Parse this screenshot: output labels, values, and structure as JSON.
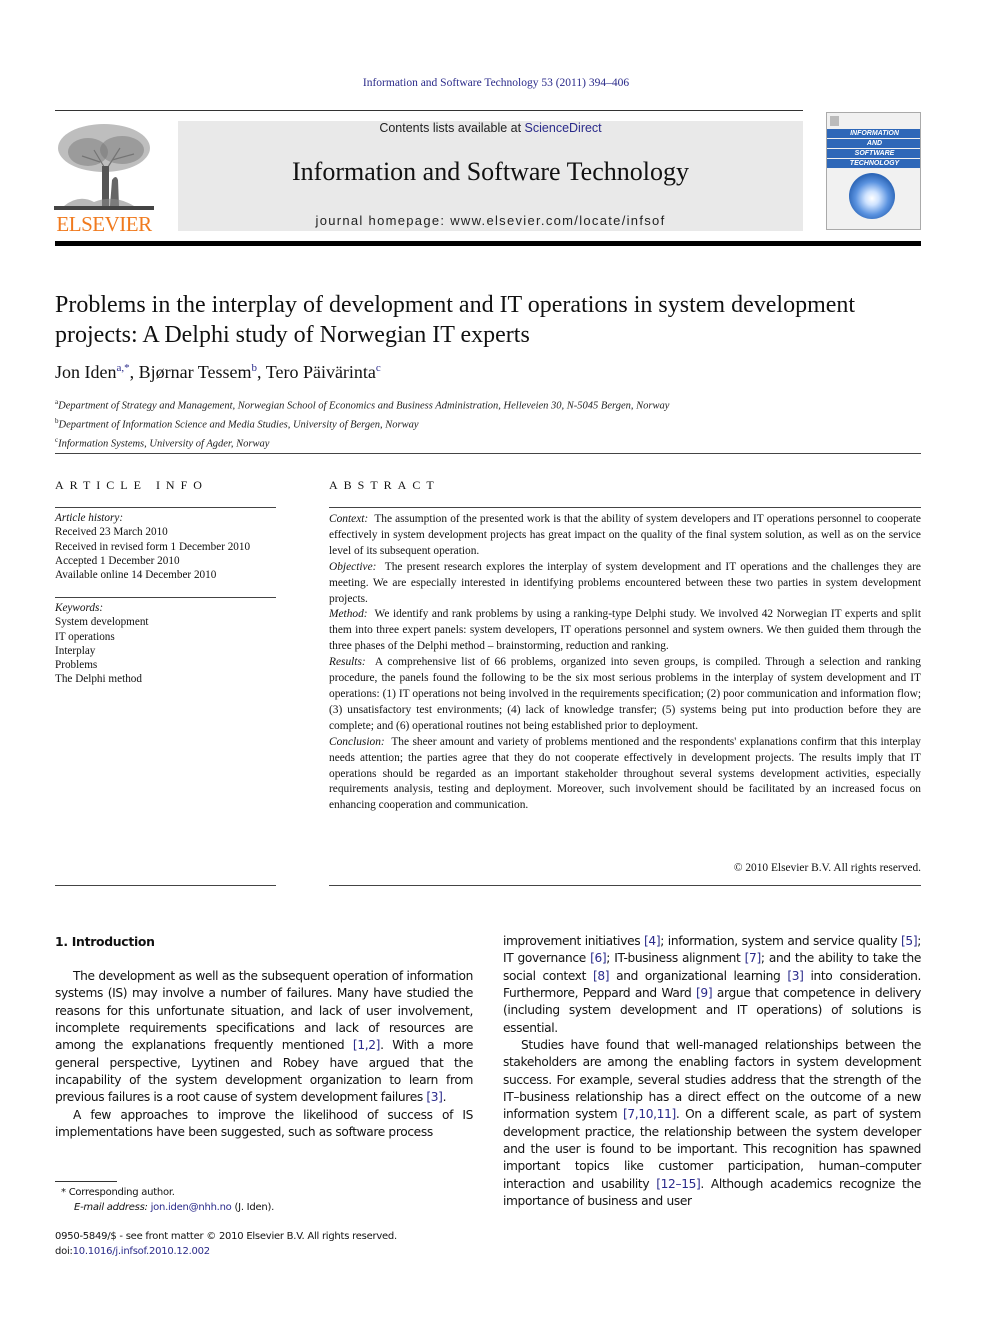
{
  "journal": {
    "running_head": "Information and Software Technology 53 (2011) 394–406",
    "contents_prefix": "Contents lists available at ",
    "contents_link": "ScienceDirect",
    "title": "Information and Software Technology",
    "homepage": "journal homepage: www.elsevier.com/locate/infsof",
    "publisher_logo": "ELSEVIER",
    "cover_lines": [
      "INFORMATION",
      "AND",
      "SOFTWARE",
      "TECHNOLOGY"
    ],
    "brand_color": "#f07a1e",
    "link_color": "#2a2a8a",
    "cover_color": "#2e67b8"
  },
  "article": {
    "title": "Problems in the interplay of development and IT operations in system development projects: A Delphi study of Norwegian IT experts",
    "authors": [
      {
        "name": "Jon Iden",
        "marks": "a,*",
        "sep": ", "
      },
      {
        "name": "Bjørnar Tessem",
        "marks": "b",
        "sep": ", "
      },
      {
        "name": "Tero Päivärinta",
        "marks": "c",
        "sep": ""
      }
    ],
    "affiliations": [
      {
        "mark": "a",
        "text": "Department of Strategy and Management, Norwegian School of Economics and Business Administration, Helleveien 30, N-5045 Bergen, Norway"
      },
      {
        "mark": "b",
        "text": "Department of Information Science and Media Studies, University of Bergen, Norway"
      },
      {
        "mark": "c",
        "text": "Information Systems, University of Agder, Norway"
      }
    ]
  },
  "article_info": {
    "heading": "ARTICLE INFO",
    "history_label": "Article history:",
    "history": [
      "Received 23 March 2010",
      "Received in revised form 1 December 2010",
      "Accepted 1 December 2010",
      "Available online 14 December 2010"
    ],
    "keywords_label": "Keywords:",
    "keywords": [
      "System development",
      "IT operations",
      "Interplay",
      "Problems",
      "The Delphi method"
    ]
  },
  "abstract": {
    "heading": "ABSTRACT",
    "sections": [
      {
        "label": "Context:",
        "text": "The assumption of the presented work is that the ability of system developers and IT operations personnel to cooperate effectively in system development projects has great impact on the quality of the final system solution, as well as on the service level of its subsequent operation."
      },
      {
        "label": "Objective:",
        "text": "The present research explores the interplay of system development and IT operations and the challenges they are meeting. We are especially interested in identifying problems encountered between these two parties in system development projects."
      },
      {
        "label": "Method:",
        "text": "We identify and rank problems by using a ranking-type Delphi study. We involved 42 Norwegian IT experts and split them into three expert panels: system developers, IT operations personnel and system owners. We then guided them through the three phases of the Delphi method – brainstorming, reduction and ranking."
      },
      {
        "label": "Results:",
        "text": "A comprehensive list of 66 problems, organized into seven groups, is compiled. Through a selection and ranking procedure, the panels found the following to be the six most serious problems in the interplay of system development and IT operations: (1) IT operations not being involved in the requirements specification; (2) poor communication and information flow; (3) unsatisfactory test environments; (4) lack of knowledge transfer; (5) systems being put into production before they are complete; and (6) operational routines not being established prior to deployment."
      },
      {
        "label": "Conclusion:",
        "text": "The sheer amount and variety of problems mentioned and the respondents' explanations confirm that this interplay needs attention; the parties agree that they do not cooperate effectively in development projects. The results imply that IT operations should be regarded as an important stakeholder throughout several systems development activities, especially requirements analysis, testing and deployment. Moreover, such involvement should be facilitated by an increased focus on enhancing cooperation and communication."
      }
    ],
    "copyright": "© 2010 Elsevier B.V. All rights reserved."
  },
  "body": {
    "section_heading": "1. Introduction",
    "col1": {
      "p1_a": "The development as well as the subsequent operation of information systems (IS) may involve a number of failures. Many have studied the reasons for this unfortunate situation, and lack of user involvement, incomplete requirements specifications and lack of resources are among the explanations frequently mentioned ",
      "p1_ref1": "[1,2]",
      "p1_b": ". With a more general perspective, Lyytinen and Robey have argued that the incapability of the system development organization to learn from previous failures is a root cause of system development failures ",
      "p1_ref2": "[3]",
      "p1_c": ".",
      "p2": "A few approaches to improve the likelihood of success of IS implementations have been suggested, such as software process"
    },
    "col2": {
      "p1_a": "improvement initiatives ",
      "ref4": "[4]",
      "p1_b": "; information, system and service quality ",
      "ref5": "[5]",
      "p1_c": "; IT governance ",
      "ref6": "[6]",
      "p1_d": "; IT-business alignment ",
      "ref7": "[7]",
      "p1_e": "; and the ability to take the social context ",
      "ref8": "[8]",
      "p1_f": " and organizational learning ",
      "ref3": "[3]",
      "p1_g": " into consideration. Furthermore, Peppard and Ward ",
      "ref9": "[9]",
      "p1_h": " argue that competence in delivery (including system development and IT operations) of solutions is essential.",
      "p2_a": "Studies have found that well-managed relationships between the stakeholders are among the enabling factors in system development success. For example, several studies address that the strength of the IT–business relationship has a direct effect on the outcome of a new information system ",
      "ref71011": "[7,10,11]",
      "p2_b": ". On a different scale, as part of system development practice, the relationship between the system developer and the user is found to be important. This recognition has spawned important topics like customer participation, human–computer interaction and usability ",
      "ref1215": "[12–15]",
      "p2_c": ". Although academics recognize the importance of business and user"
    }
  },
  "footnotes": {
    "corresponding_mark": "*",
    "corresponding": "Corresponding author.",
    "email_label": "E-mail address:",
    "email": "jon.iden@nhh.no",
    "email_suffix": " (J. Iden).",
    "front_matter": "0950-5849/$ - see front matter © 2010 Elsevier B.V. All rights reserved.",
    "doi_label": "doi:",
    "doi": "10.1016/j.infsof.2010.12.002"
  }
}
